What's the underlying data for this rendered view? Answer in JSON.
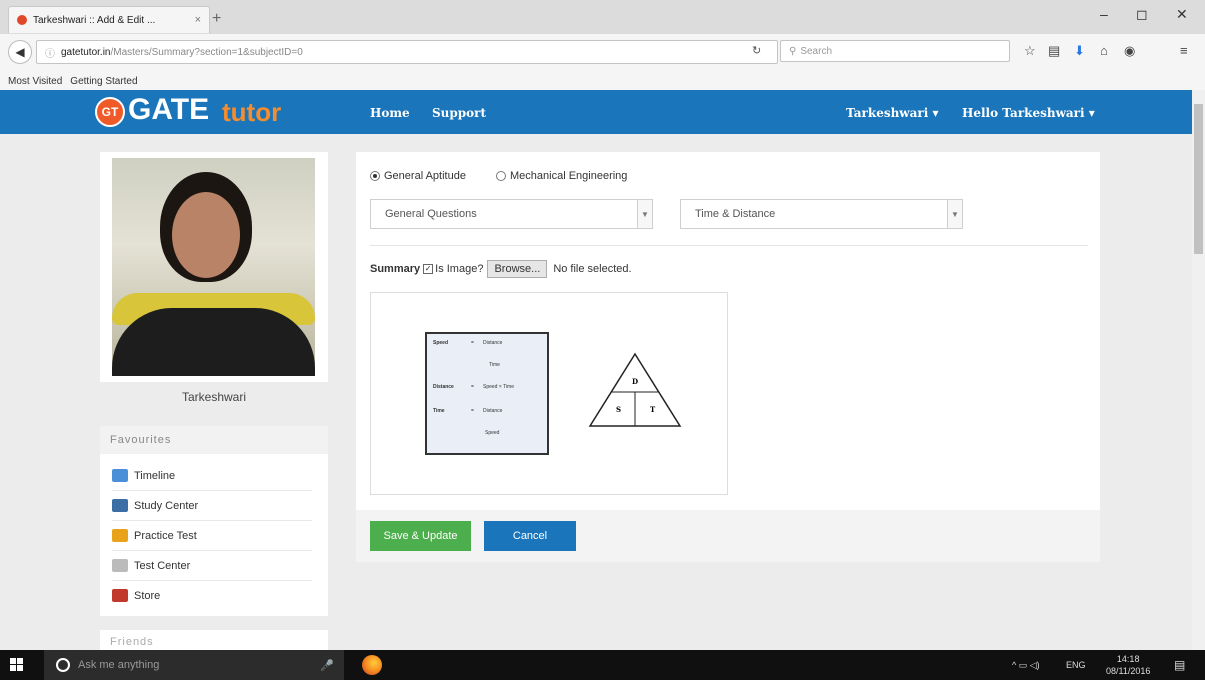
{
  "browser": {
    "tab_title": "Tarkeshwari :: Add & Edit ...",
    "tab_close": "×",
    "new_tab": "+",
    "url_host": "gatetutor.in",
    "url_path": "/Masters/Summary?section=1&subjectID=0",
    "search_placeholder": "Search",
    "bookmarks": [
      "Most Visited",
      "Getting Started"
    ]
  },
  "site": {
    "logo_badge": "GT",
    "logo_gate": "GATE",
    "logo_tutor": "tutor",
    "nav": [
      "Home",
      "Support"
    ],
    "user_menu": "Tarkeshwari ▾",
    "greeting_menu": "Hello Tarkeshwari ▾",
    "header_color": "#1a75bb"
  },
  "sidebar": {
    "profile_name": "Tarkeshwari",
    "favourites_title": "Favourites",
    "favourites": [
      {
        "label": "Timeline",
        "icon": "timeline-icon",
        "color": "#4a90d9"
      },
      {
        "label": "Study Center",
        "icon": "study-center-icon",
        "color": "#3a6ea5"
      },
      {
        "label": "Practice Test",
        "icon": "practice-test-icon",
        "color": "#e9a31b"
      },
      {
        "label": "Test Center",
        "icon": "test-center-icon",
        "color": "#bbbbbb"
      },
      {
        "label": "Store",
        "icon": "store-icon",
        "color": "#c0392b"
      }
    ],
    "friends_title": "Friends"
  },
  "form": {
    "subject_options": [
      {
        "label": "General Aptitude",
        "selected": true
      },
      {
        "label": "Mechanical Engineering",
        "selected": false
      }
    ],
    "category_select": "General Questions",
    "topic_select": "Time & Distance",
    "summary_label": "Summary",
    "is_image_label": "Is Image?",
    "is_image_checked": true,
    "browse_label": "Browse...",
    "file_status": "No file selected.",
    "save_label": "Save & Update",
    "cancel_label": "Cancel",
    "save_color": "#4cae4c",
    "cancel_color": "#1a75bb"
  },
  "formula_image": {
    "rows": [
      {
        "left": "Speed",
        "eq": "=",
        "right": "Distance"
      },
      {
        "left": "",
        "eq": "",
        "right": "Time"
      },
      {
        "left": "Distance",
        "eq": "=",
        "right": "Speed × Time"
      },
      {
        "left": "Time",
        "eq": "=",
        "right": "Distance"
      },
      {
        "left": "",
        "eq": "",
        "right": "Speed"
      }
    ],
    "triangle_top": "D",
    "triangle_left": "S",
    "triangle_right": "T"
  },
  "taskbar": {
    "search_placeholder": "Ask me anything",
    "lang": "ENG",
    "time": "14:18",
    "date": "08/11/2016"
  }
}
